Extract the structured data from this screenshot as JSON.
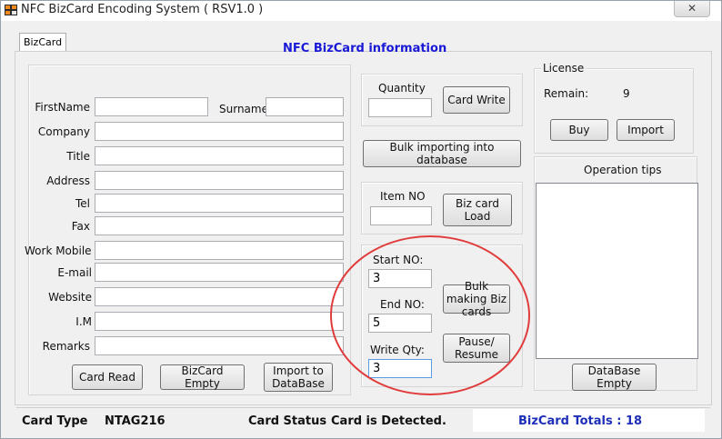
{
  "window": {
    "title": "NFC BizCard Encoding System ( RSV1.0 )",
    "close_glyph": "✕"
  },
  "tab": {
    "label": "BizCard"
  },
  "heading": "NFC BizCard information",
  "form": {
    "fields": [
      {
        "label": "FirstName",
        "value": ""
      },
      {
        "label": "Surname",
        "value": ""
      },
      {
        "label": "Company",
        "value": ""
      },
      {
        "label": "Title",
        "value": ""
      },
      {
        "label": "Address",
        "value": ""
      },
      {
        "label": "Tel",
        "value": ""
      },
      {
        "label": "Fax",
        "value": ""
      },
      {
        "label": "Work Mobile",
        "value": ""
      },
      {
        "label": "E-mail",
        "value": ""
      },
      {
        "label": "Website",
        "value": ""
      },
      {
        "label": "I.M",
        "value": ""
      },
      {
        "label": "Remarks",
        "value": ""
      }
    ],
    "buttons": {
      "card_read": "Card Read",
      "bizcard_empty": "BizCard Empty",
      "import_to_database": "Import to DataBase"
    }
  },
  "write_panel": {
    "quantity_label": "Quantity",
    "quantity_value": "",
    "card_write": "Card Write"
  },
  "bulk_import": {
    "label": "Bulk importing into database"
  },
  "load_panel": {
    "item_no_label": "Item NO",
    "item_no_value": "",
    "biz_card_load": "Biz card Load"
  },
  "bulk_panel": {
    "start_label": "Start NO:",
    "start_value": "3",
    "end_label": "End NO:",
    "end_value": "5",
    "qty_label": "Write Qty:",
    "qty_value": "3",
    "bulk_making": "Bulk making Biz cards",
    "pause_resume": "Pause/ Resume"
  },
  "license": {
    "title": "License",
    "remain_label": "Remain:",
    "remain_value": "9",
    "buy": "Buy",
    "import": "Import"
  },
  "tips": {
    "title": "Operation tips",
    "content": ""
  },
  "database_empty": "DataBase Empty",
  "status": {
    "card_type_label": "Card Type",
    "card_type_value": "NTAG216",
    "card_status_label": "Card Status",
    "card_status_value": "Card is Detected.",
    "totals": "BizCard Totals : 18"
  },
  "colors": {
    "heading": "#1818d6",
    "totals": "#1d2fb8",
    "annotation_circle": "#e03c3c"
  }
}
